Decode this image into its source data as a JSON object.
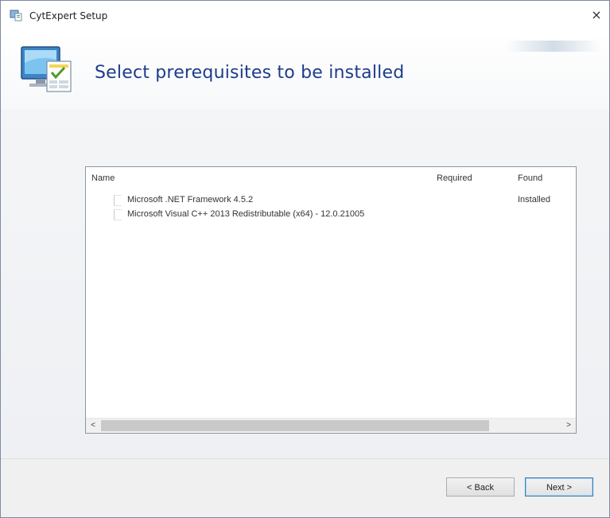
{
  "window": {
    "title": "CytExpert Setup",
    "close_glyph": "×"
  },
  "header": {
    "title": "Select prerequisites to be installed",
    "icon": "installer-computer-icon"
  },
  "prerequisites": {
    "columns": {
      "name": "Name",
      "required": "Required",
      "found": "Found"
    },
    "rows": [
      {
        "checked": false,
        "name": "Microsoft .NET Framework 4.5.2",
        "required": "",
        "found": "Installed"
      },
      {
        "checked": false,
        "name": "Microsoft Visual C++ 2013 Redistributable (x64) - 12.0.21005",
        "required": "",
        "found": ""
      }
    ],
    "scroll_left": "<",
    "scroll_right": ">"
  },
  "footer": {
    "back_label": "< Back",
    "next_label": "Next >"
  },
  "colors": {
    "title_blue": "#1e3c8c",
    "focus_border": "#3c7fb1"
  }
}
